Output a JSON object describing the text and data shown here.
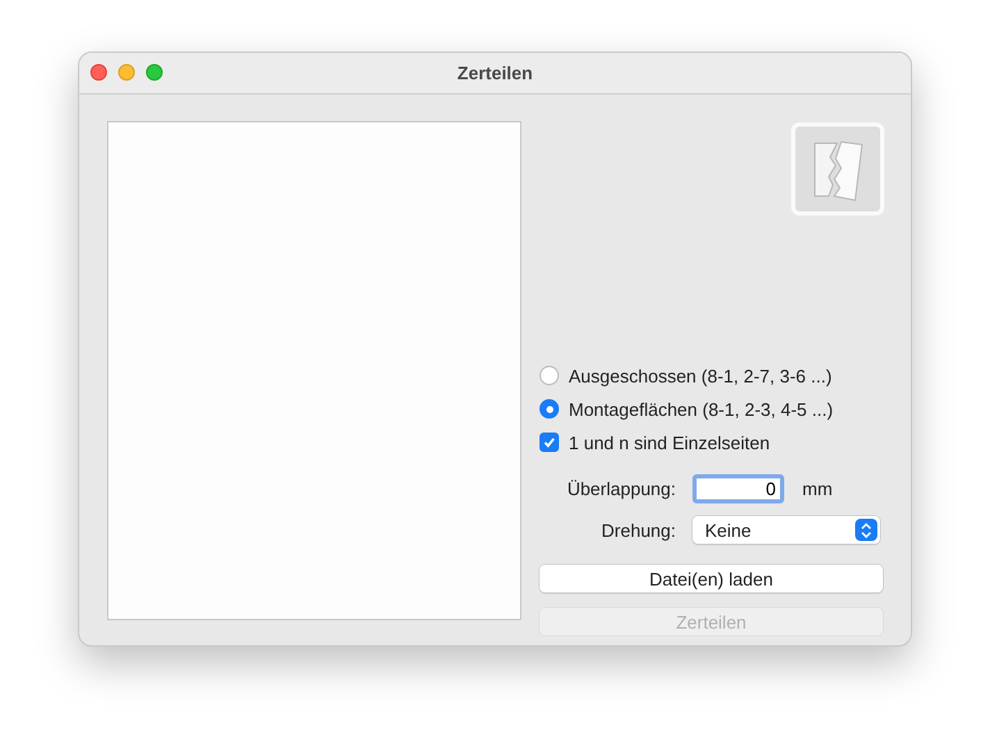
{
  "window": {
    "title": "Zerteilen"
  },
  "options": [
    {
      "kind": "radio",
      "label": "Ausgeschossen (8-1, 2-7, 3-6 ...)",
      "selected": false
    },
    {
      "kind": "radio",
      "label": "Montageflächen (8-1, 2-3, 4-5 ...)",
      "selected": true
    },
    {
      "kind": "checkbox",
      "label": "1 und n sind Einzelseiten",
      "checked": true
    }
  ],
  "overlap": {
    "label": "Überlappung:",
    "value": "0",
    "unit": "mm"
  },
  "rotation": {
    "label": "Drehung:",
    "value": "Keine"
  },
  "buttons": [
    {
      "label": "Datei(en) laden",
      "disabled": false
    },
    {
      "label": "Zerteilen",
      "disabled": true
    }
  ]
}
